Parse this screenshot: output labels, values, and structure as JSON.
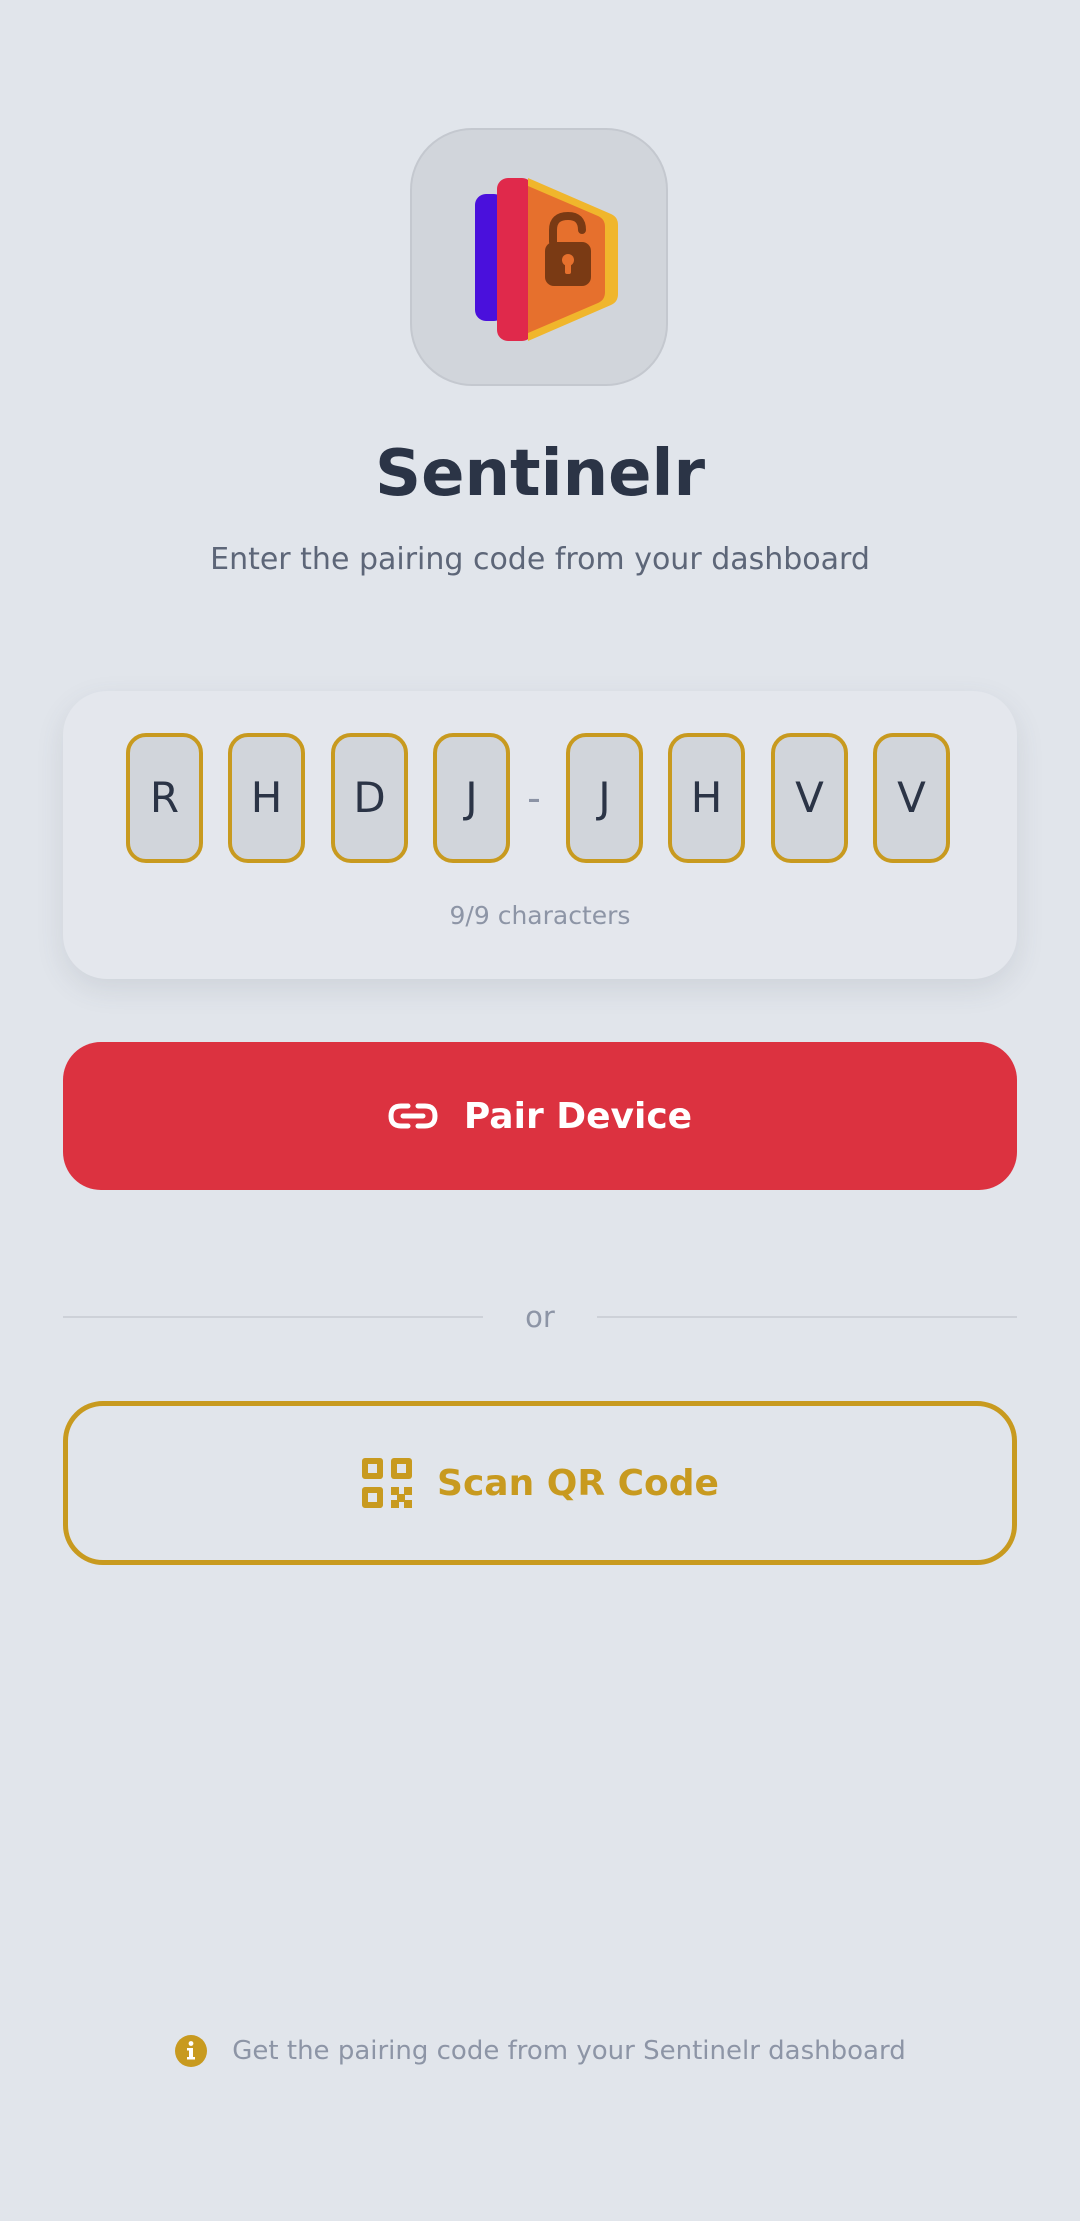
{
  "app": {
    "name": "Sentinelr",
    "subtitle": "Enter the pairing code from your dashboard",
    "logo_icon": "lock-cards-logo"
  },
  "pairing_code": {
    "characters": [
      "R",
      "H",
      "D",
      "J",
      "J",
      "H",
      "V",
      "V"
    ],
    "separator": "-",
    "count_label": "9/9 characters"
  },
  "actions": {
    "pair_label": "Pair Device",
    "pair_icon": "link-icon",
    "divider_label": "or",
    "scan_label": "Scan QR Code",
    "scan_icon": "qr-code-icon"
  },
  "footer": {
    "hint": "Get the pairing code from your Sentinelr dashboard",
    "icon": "info-icon"
  },
  "colors": {
    "background": "#e1e5eb",
    "primary": "#dc3240",
    "accent": "#c89a1f",
    "text": "#2b3446",
    "muted": "#8d95a6"
  }
}
